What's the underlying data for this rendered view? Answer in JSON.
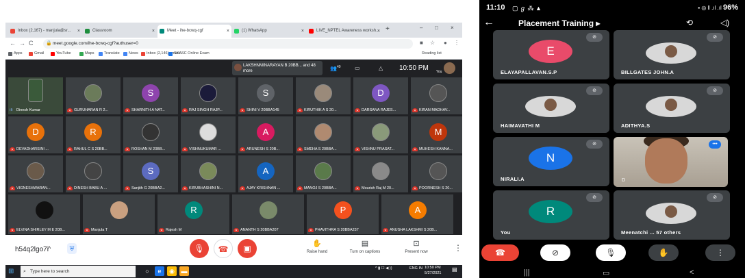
{
  "browser": {
    "tabs": [
      {
        "label": "Inbox (2,167) - manjula@sr...",
        "fav": "#ea4335",
        "active": false
      },
      {
        "label": "Classroom",
        "fav": "#1e8e3e",
        "active": false
      },
      {
        "label": "Meet - ihe-bcwq-cgf",
        "fav": "#00897b",
        "active": true
      },
      {
        "label": "(1) WhatsApp",
        "fav": "#25d366",
        "active": false
      },
      {
        "label": "LIVE_NPTEL Awareness worksh...",
        "fav": "#ff0000",
        "active": false
      }
    ],
    "url": "meet.google.com/ihe-bcwq-cgf?authuser=0",
    "bookmarks": [
      {
        "label": "Apps",
        "color": "#5f6368"
      },
      {
        "label": "Gmail",
        "color": "#ea4335"
      },
      {
        "label": "YouTube",
        "color": "#ff0000"
      },
      {
        "label": "Maps",
        "color": "#34a853"
      },
      {
        "label": "Translate",
        "color": "#4285f4"
      },
      {
        "label": "News",
        "color": "#4285f4"
      },
      {
        "label": "Inbox (2,146) - man...",
        "color": "#ea4335"
      },
      {
        "label": "SKASC Online Exam",
        "color": "#1a73e8"
      }
    ],
    "reading_list": "Reading list"
  },
  "meet": {
    "speaking_names": "LAKSHNMINARAYAN B 20BB... and 48 more",
    "participant_count": "49",
    "time": "10:50 PM",
    "you_label": "You",
    "tiles": [
      {
        "name": "Dinesh Kumar",
        "initial": "",
        "color": "#3a5a3a",
        "photo": true,
        "speaking": true
      },
      {
        "name": "GURUHARAN R 2...",
        "initial": "",
        "color": "#6b7b5a",
        "photo": true
      },
      {
        "name": "SHARNITH A NAT...",
        "initial": "S",
        "color": "#8e44ad"
      },
      {
        "name": "RAJ SINGH RAJP...",
        "initial": "",
        "color": "#1b1b3a",
        "photo": true
      },
      {
        "name": "SHINI V 20BBA145",
        "initial": "S",
        "color": "#5f6368"
      },
      {
        "name": "KIRUTHIK A S 20...",
        "initial": "",
        "color": "#9a8a7a",
        "photo": true
      },
      {
        "name": "DARSANA RAJES...",
        "initial": "D",
        "color": "#7e57c2"
      },
      {
        "name": "KIRAN MADHAV...",
        "initial": "",
        "color": "#555",
        "photo": true
      },
      {
        "name": "DEVADHARSINI ...",
        "initial": "D",
        "color": "#e8710a"
      },
      {
        "name": "RAHUL C S 20BB...",
        "initial": "R",
        "color": "#e8710a"
      },
      {
        "name": "ROSHAN M 20BB...",
        "initial": "",
        "color": "#333",
        "photo": true
      },
      {
        "name": "VISHNUKUMAR ...",
        "initial": "",
        "color": "#ddd",
        "photo": true
      },
      {
        "name": "ARUNESH S 20B...",
        "initial": "A",
        "color": "#d81b60"
      },
      {
        "name": "SMEHA S 20BBA...",
        "initial": "",
        "color": "#b08a70",
        "photo": true
      },
      {
        "name": "VISHNU PRASAT...",
        "initial": "",
        "color": "#8a9a7a",
        "photo": true
      },
      {
        "name": "MUHESH KANNA...",
        "initial": "M",
        "color": "#bf360c"
      },
      {
        "name": "VIGNESHWARAN...",
        "initial": "",
        "color": "#6a5a4a",
        "photo": true
      },
      {
        "name": "DINESH BABU A ...",
        "initial": "",
        "color": "#444",
        "photo": true
      },
      {
        "name": "Sanjith G 20BBA2...",
        "initial": "S",
        "color": "#5c6bc0"
      },
      {
        "name": "KIRUBHASHINI N...",
        "initial": "",
        "color": "#7a8a5a",
        "photo": true
      },
      {
        "name": "AJAY KRISHNAN ...",
        "initial": "A",
        "color": "#1565c0"
      },
      {
        "name": "MANOJ S 20BBA...",
        "initial": "",
        "color": "#5a7a4a",
        "photo": true
      },
      {
        "name": "Mourish Raj M 20...",
        "initial": "",
        "color": "#8a8a8a",
        "photo": true
      },
      {
        "name": "POORNESH S 20...",
        "initial": "",
        "color": "#555",
        "photo": true,
        "more": true
      }
    ],
    "bottom_tiles": [
      {
        "name": "ELVINA SHIRLEY M E 20B...",
        "initial": "",
        "color": "#111",
        "photo": true
      },
      {
        "name": "Manjula T",
        "initial": "",
        "color": "#c9a080",
        "photo": true
      },
      {
        "name": "Rajesh M",
        "initial": "R",
        "color": "#00897b"
      },
      {
        "name": "ANANTH S 20BBA207",
        "initial": "",
        "color": "#7a8a6a",
        "photo": true
      },
      {
        "name": "PHAVITHRA S 20BBA237",
        "initial": "P",
        "color": "#f4511e"
      },
      {
        "name": "ANUSHA LAKSHMI S 20B...",
        "initial": "A",
        "color": "#f57c00"
      }
    ],
    "meeting_code": "h54q2lgo7i",
    "actions": [
      {
        "icon": "✋",
        "label": "Raise hand"
      },
      {
        "icon": "▤",
        "label": "Turn on captions"
      },
      {
        "icon": "⊡",
        "label": "Present now"
      }
    ]
  },
  "taskbar": {
    "search_placeholder": "Type here to search",
    "lang": "ENG IN",
    "time": "10:50 PM",
    "date": "5/27/2021"
  },
  "phone": {
    "time": "11:10",
    "battery": "96%",
    "title": "Placement Training",
    "tiles": [
      {
        "name": "ELAYAPALLAVAN.S.P",
        "initial": "E",
        "color": "#e94b6a",
        "photo": false
      },
      {
        "name": "BILLGATES JOHN.A",
        "initial": "",
        "color": "",
        "photo": true
      },
      {
        "name": "HAIMAVATHI M",
        "initial": "",
        "color": "",
        "photo": true
      },
      {
        "name": "ADITHYA.S",
        "initial": "",
        "color": "",
        "photo": true
      },
      {
        "name": "NIRALI.A",
        "initial": "N",
        "color": "#1a73e8",
        "photo": false
      },
      {
        "name": "You",
        "initial": "R",
        "color": "#00897b",
        "photo": false
      },
      {
        "name": "Meenatchi ... 57 others",
        "initial": "",
        "color": "",
        "photo": true
      }
    ],
    "video_tile_label": "D"
  }
}
